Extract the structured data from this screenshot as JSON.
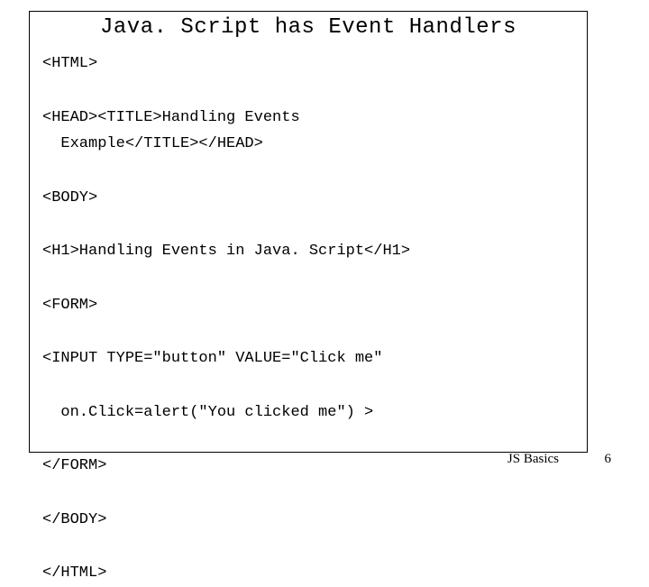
{
  "title": "Java. Script has Event Handlers",
  "code": {
    "l1": "<HTML>",
    "l2": "<HEAD><TITLE>Handling Events",
    "l3": "  Example</TITLE></HEAD>",
    "l4": "<BODY>",
    "l5": "<H1>Handling Events in Java. Script</H1>",
    "l6": "<FORM>",
    "l7": "<INPUT TYPE=\"button\" VALUE=\"Click me\"",
    "l8": "  on.Click=alert(\"You clicked me\") >",
    "l9": "</FORM>",
    "l10": "</BODY>",
    "l11": "</HTML>"
  },
  "footer": {
    "label": "JS Basics",
    "page": "6"
  }
}
